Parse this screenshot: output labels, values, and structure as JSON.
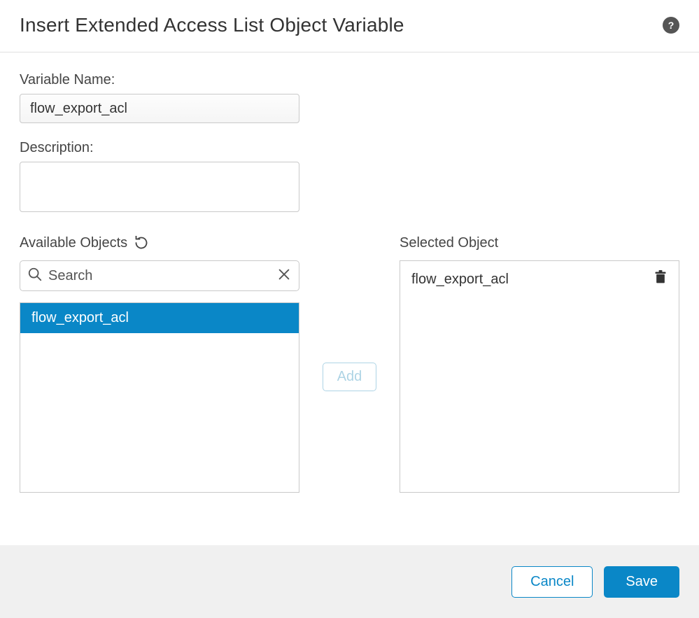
{
  "header": {
    "title": "Insert Extended Access List Object Variable"
  },
  "form": {
    "variableName": {
      "label": "Variable Name:",
      "value": "flow_export_acl"
    },
    "description": {
      "label": "Description:",
      "value": ""
    }
  },
  "available": {
    "label": "Available Objects",
    "searchPlaceholder": "Search",
    "items": [
      {
        "label": "flow_export_acl",
        "selected": true
      }
    ]
  },
  "selected": {
    "label": "Selected Object",
    "items": [
      {
        "label": "flow_export_acl"
      }
    ]
  },
  "buttons": {
    "add": "Add",
    "cancel": "Cancel",
    "save": "Save"
  }
}
